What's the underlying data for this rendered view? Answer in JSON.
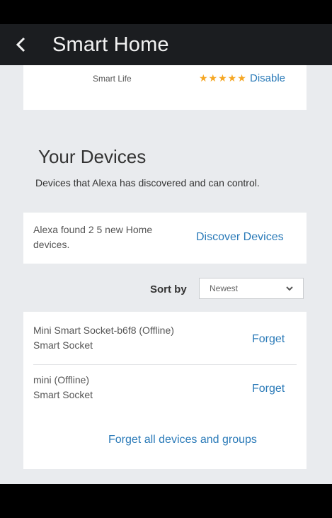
{
  "header": {
    "title": "Smart Home"
  },
  "skill": {
    "name": "Smart Life",
    "stars": "★★★★★",
    "action": "Disable"
  },
  "devices_section": {
    "title": "Your Devices",
    "description": "Devices that Alexa has discovered and can control.",
    "discover_text": "Alexa found 2 5 new Home devices.",
    "discover_link": "Discover Devices",
    "sort_label": "Sort by",
    "sort_value": "Newest",
    "forget_all": "Forget all devices and groups",
    "items": [
      {
        "name": "Mini Smart Socket-b6f8 (Offline)",
        "type": "Smart Socket",
        "action": "Forget"
      },
      {
        "name": "mini (Offline)",
        "type": "Smart Socket",
        "action": "Forget"
      }
    ]
  },
  "colors": {
    "accent": "#2a7ab8",
    "header_bg": "#1b1d20",
    "background": "#e9ebee",
    "stars": "#f5a623"
  }
}
